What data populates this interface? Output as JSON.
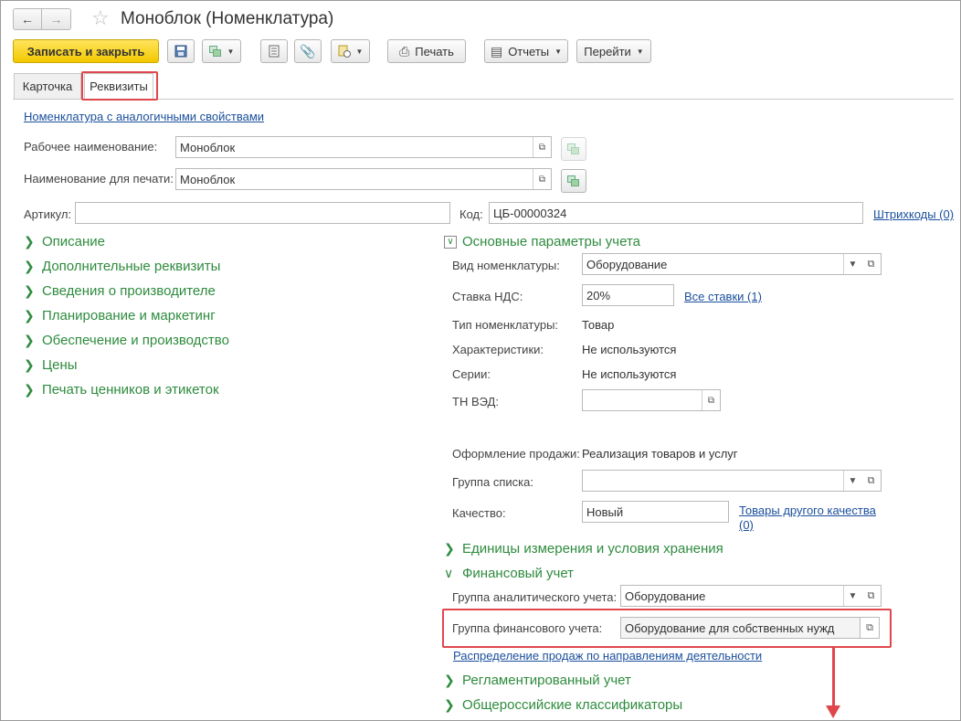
{
  "window": {
    "title": "Моноблок (Номенклатура)"
  },
  "nav": {
    "back_icon": "arrow-left-icon",
    "forward_icon": "arrow-right-icon",
    "favorite_icon": "star-icon"
  },
  "toolbar": {
    "save_close": "Записать и закрыть",
    "print": "Печать",
    "reports": "Отчеты",
    "goto": "Перейти"
  },
  "tabs": [
    {
      "label": "Карточка"
    },
    {
      "label": "Реквизиты"
    }
  ],
  "form": {
    "similar_link": "Номенклатура с аналогичными свойствами",
    "work_name_label": "Рабочее наименование:",
    "work_name_value": "Моноблок",
    "print_name_label": "Наименование для печати:",
    "print_name_value": "Моноблок",
    "article_label": "Артикул:",
    "article_value": "",
    "code_label": "Код:",
    "code_value": "ЦБ-00000324",
    "barcodes_link": "Штрихкоды (0)"
  },
  "left_sections": [
    {
      "label": "Описание"
    },
    {
      "label": "Дополнительные реквизиты"
    },
    {
      "label": "Сведения о производителе"
    },
    {
      "label": "Планирование и маркетинг"
    },
    {
      "label": "Обеспечение и производство"
    },
    {
      "label": "Цены"
    },
    {
      "label": "Печать ценников и этикеток"
    }
  ],
  "params": {
    "title": "Основные параметры учета",
    "kind_label": "Вид номенклатуры:",
    "kind_value": "Оборудование",
    "vat_label": "Ставка НДС:",
    "vat_value": "20%",
    "all_rates_link": "Все ставки (1)",
    "type_label": "Тип номенклатуры:",
    "type_value": "Товар",
    "chars_label": "Характеристики:",
    "chars_value": "Не используются",
    "series_label": "Серии:",
    "series_value": "Не используются",
    "tnved_label": "ТН ВЭД:",
    "tnved_value": "",
    "sales_label": "Оформление продажи:",
    "sales_value": "Реализация товаров и услуг",
    "list_group_label": "Группа списка:",
    "list_group_value": "",
    "quality_label": "Качество:",
    "quality_value": "Новый",
    "other_quality_link_1": "Товары другого качества",
    "other_quality_link_2": "(0)"
  },
  "units_section": "Единицы измерения и условия хранения",
  "finance": {
    "title": "Финансовый учет",
    "analytic_label": "Группа аналитического учета:",
    "analytic_value": "Оборудование",
    "fin_group_label": "Группа финансового учета:",
    "fin_group_value": "Оборудование для собственных нужд",
    "distribution_link": "Распределение продаж по направлениям деятельности"
  },
  "reg_section": "Регламентированный учет",
  "okpd_section": "Общероссийские классификаторы",
  "colors": {
    "accent_green": "#2e8b3e",
    "highlight_red": "#e0474c",
    "link_blue": "#1a4f9c",
    "primary_yellow": "#f3c800"
  }
}
